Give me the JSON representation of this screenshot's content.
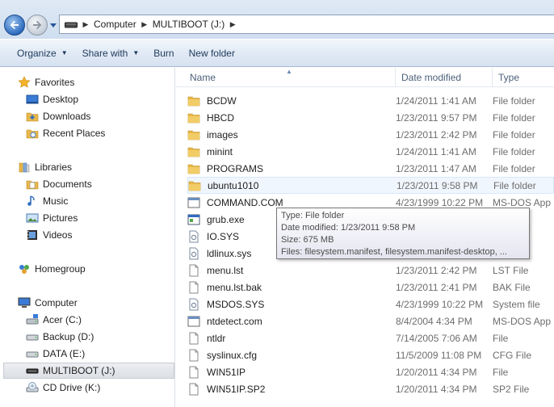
{
  "address": {
    "crumbs": [
      "Computer",
      "MULTIBOOT (J:)"
    ]
  },
  "toolbar": {
    "organize": "Organize",
    "share_with": "Share with",
    "burn": "Burn",
    "new_folder": "New folder"
  },
  "nav": {
    "favorites": "Favorites",
    "desktop": "Desktop",
    "downloads": "Downloads",
    "recent_places": "Recent Places",
    "libraries": "Libraries",
    "documents": "Documents",
    "music": "Music",
    "pictures": "Pictures",
    "videos": "Videos",
    "homegroup": "Homegroup",
    "computer": "Computer",
    "acer": "Acer (C:)",
    "backup": "Backup (D:)",
    "data": "DATA (E:)",
    "multiboot": "MULTIBOOT (J:)",
    "cd_drive": "CD Drive (K:)"
  },
  "columns": {
    "name": "Name",
    "date_modified": "Date modified",
    "type": "Type"
  },
  "files": [
    {
      "name": "BCDW",
      "date": "1/24/2011 1:41 AM",
      "type": "File folder",
      "icon": "folder-icon"
    },
    {
      "name": "HBCD",
      "date": "1/23/2011 9:57 PM",
      "type": "File folder",
      "icon": "folder-icon"
    },
    {
      "name": "images",
      "date": "1/23/2011 2:42 PM",
      "type": "File folder",
      "icon": "folder-icon"
    },
    {
      "name": "minint",
      "date": "1/24/2011 1:41 AM",
      "type": "File folder",
      "icon": "folder-icon"
    },
    {
      "name": "PROGRAMS",
      "date": "1/23/2011 1:47 AM",
      "type": "File folder",
      "icon": "folder-icon"
    },
    {
      "name": "ubuntu1010",
      "date": "1/23/2011 9:58 PM",
      "type": "File folder",
      "icon": "folder-icon"
    },
    {
      "name": "COMMAND.COM",
      "date": "4/23/1999 10:22 PM",
      "type": "MS-DOS App",
      "icon": "app-icon"
    },
    {
      "name": "grub.exe",
      "date": "",
      "type": "ation",
      "icon": "exe-icon"
    },
    {
      "name": "IO.SYS",
      "date": "",
      "type": "",
      "icon": "system-file-icon"
    },
    {
      "name": "ldlinux.sys",
      "date": "",
      "type": "",
      "icon": "system-file-icon"
    },
    {
      "name": "menu.lst",
      "date": "1/23/2011 2:42 PM",
      "type": "LST File",
      "icon": "file-icon"
    },
    {
      "name": "menu.lst.bak",
      "date": "1/23/2011 2:41 PM",
      "type": "BAK File",
      "icon": "file-icon"
    },
    {
      "name": "MSDOS.SYS",
      "date": "4/23/1999 10:22 PM",
      "type": "System file",
      "icon": "system-file-icon"
    },
    {
      "name": "ntdetect.com",
      "date": "8/4/2004 4:34 PM",
      "type": "MS-DOS App",
      "icon": "app-icon"
    },
    {
      "name": "ntldr",
      "date": "7/14/2005 7:06 AM",
      "type": "File",
      "icon": "file-icon"
    },
    {
      "name": "syslinux.cfg",
      "date": "11/5/2009 11:08 PM",
      "type": "CFG File",
      "icon": "file-icon"
    },
    {
      "name": "WIN51IP",
      "date": "1/20/2011 4:34 PM",
      "type": "File",
      "icon": "file-icon"
    },
    {
      "name": "WIN51IP.SP2",
      "date": "1/20/2011 4:34 PM",
      "type": "SP2 File",
      "icon": "file-icon"
    }
  ],
  "tooltip": {
    "type": "Type: File folder",
    "date": "Date modified: 1/23/2011 9:58 PM",
    "size": "Size: 675 MB",
    "files": "Files: filesystem.manifest, filesystem.manifest-desktop, ..."
  },
  "colors": {
    "folder": "#e8b84a",
    "accent": "#2f6cc0"
  }
}
